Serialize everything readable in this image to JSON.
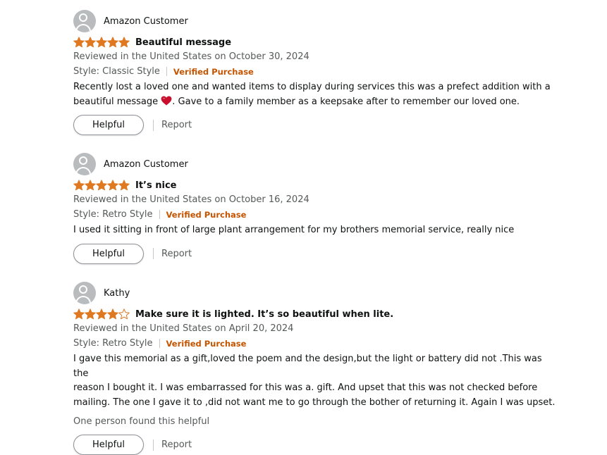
{
  "colors": {
    "star": "#de7921",
    "verified": "#c45500",
    "heart": "#c8102e",
    "meta": "#565959"
  },
  "icons": {
    "avatar": "user-avatar-icon",
    "star_full": "star-filled-icon",
    "star_empty": "star-empty-icon",
    "heart": "red-heart-emoji"
  },
  "reviews": [
    {
      "name": "Amazon Customer",
      "rating": 5,
      "title": "Beautiful message",
      "date_line": "Reviewed in the United States on October 30, 2024",
      "style": "Style: Classic Style",
      "verified": "Verified Purchase",
      "body_line1": "Recently lost a loved one and wanted items to display during services this was a prefect addition with a",
      "body_line2a": "beautiful message ",
      "body_line2b": ". Gave to a family member as a keepsake after to remember our loved one.",
      "helpful_label": "Helpful",
      "report_label": "Report"
    },
    {
      "name": "Amazon Customer",
      "rating": 5,
      "title": "It’s nice",
      "date_line": "Reviewed in the United States on October 16, 2024",
      "style": "Style: Retro Style",
      "verified": "Verified Purchase",
      "body": "I used it sitting in front of large plant arrangement for my brothers memorial service, really nice",
      "helpful_label": "Helpful",
      "report_label": "Report"
    },
    {
      "name": "Kathy",
      "rating": 4,
      "title": "Make sure it is lighted. It’s so beautiful when lite.",
      "date_line": "Reviewed in the United States on April 20, 2024",
      "style": "Style: Retro Style",
      "verified": "Verified Purchase",
      "body_line1": "I gave this memorial as a gift,loved the poem and the design,but the light or battery did not .This was the",
      "body_line2": "reason I bought it. I was embarrassed for this was a. gift. And upset that this was not checked before",
      "body_line3": "mailing. The one I gave it to ,did not want me to go through the bother of returning it. Again I was upset.",
      "helpful_count": "One person found this helpful",
      "helpful_label": "Helpful",
      "report_label": "Report"
    }
  ]
}
